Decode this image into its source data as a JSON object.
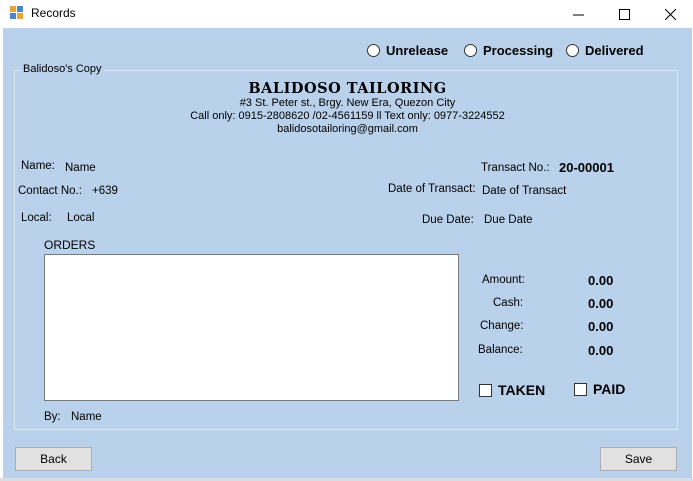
{
  "window": {
    "title": "Records"
  },
  "status_options": [
    "Unrelease",
    "Processing",
    "Delivered"
  ],
  "groupbox": {
    "legend": "Balidoso's Copy"
  },
  "company": {
    "name": "BALIDOSO TAILORING",
    "address": "#3 St. Peter st., Brgy. New Era, Quezon City",
    "phone": "Call only: 0915-2808620 /02-4561159 ll Text only: 0977-3224552",
    "email": "balidosotailoring@gmail.com"
  },
  "customer": {
    "name_label": "Name:",
    "name_value": "Name",
    "contact_label": "Contact No.:",
    "contact_value": "+639",
    "local_label": "Local:",
    "local_value": "Local"
  },
  "transaction": {
    "transact_label": "Transact No.:",
    "transact_value": "20-00001",
    "date_label": "Date of Transact:",
    "date_value": "Date of Transact",
    "due_label": "Due Date:",
    "due_value": "Due Date"
  },
  "orders": {
    "label": "ORDERS"
  },
  "payment": {
    "amount_label": "Amount:",
    "amount_value": "0.00",
    "cash_label": "Cash:",
    "cash_value": "0.00",
    "change_label": "Change:",
    "change_value": "0.00",
    "balance_label": "Balance:",
    "balance_value": "0.00"
  },
  "flags": {
    "taken": "TAKEN",
    "paid": "PAID"
  },
  "by": {
    "label": "By:",
    "value": "Name"
  },
  "buttons": {
    "back": "Back",
    "save": "Save"
  }
}
